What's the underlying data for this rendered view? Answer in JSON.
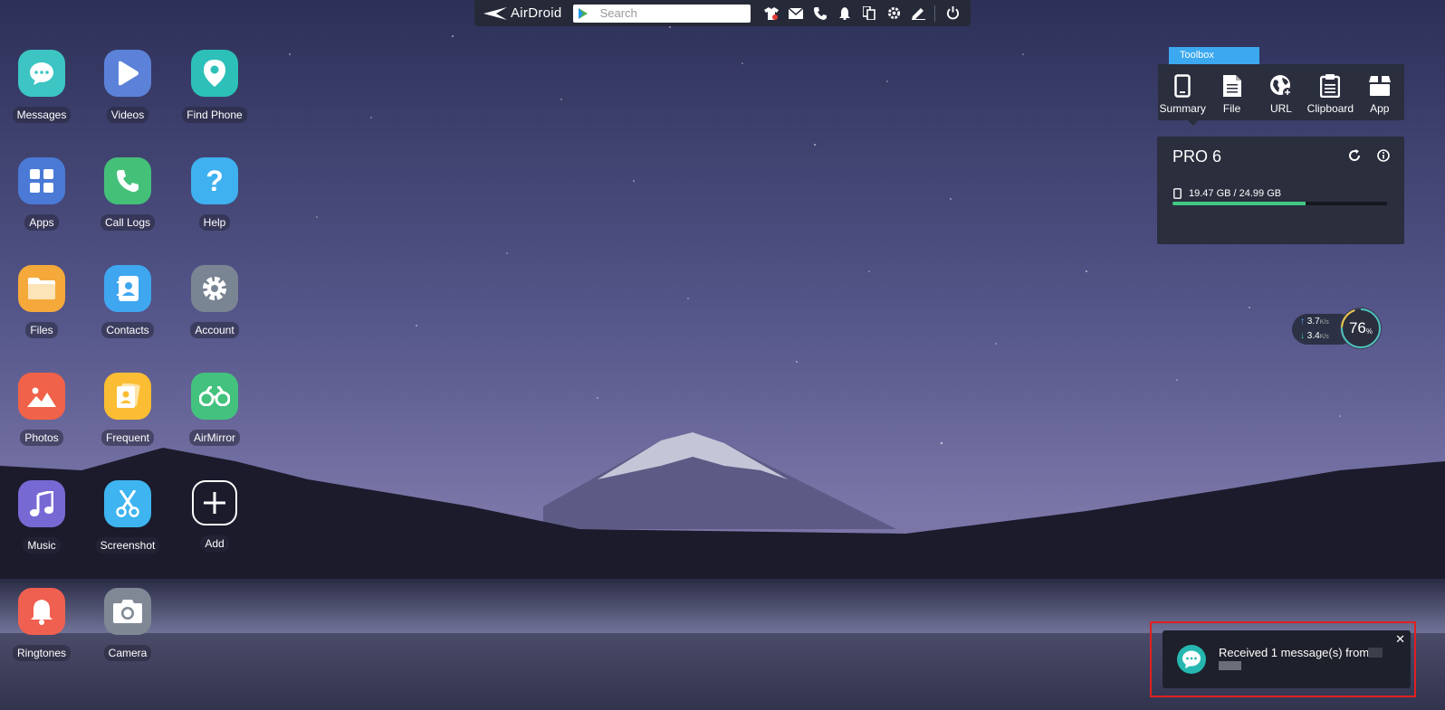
{
  "topbar": {
    "logo_text": "AirDroid",
    "search_placeholder": "Search",
    "icons": [
      "tshirt-icon",
      "mail-icon",
      "phone-icon",
      "bell-icon",
      "transfer-icon",
      "gear-icon",
      "pen-icon",
      "power-icon"
    ]
  },
  "apps": [
    {
      "label": "Messages",
      "color": "#3cc5c2",
      "icon": "chat-bubble-icon"
    },
    {
      "label": "Videos",
      "color": "#5b82d8",
      "icon": "play-icon"
    },
    {
      "label": "Find Phone",
      "color": "#2cc0b9",
      "icon": "location-pin-icon"
    },
    {
      "label": "Apps",
      "color": "#4a7ad6",
      "icon": "grid-icon"
    },
    {
      "label": "Call Logs",
      "color": "#45c079",
      "icon": "phone-call-icon"
    },
    {
      "label": "Help",
      "color": "#3fb1f0",
      "icon": "question-icon"
    },
    {
      "label": "Files",
      "color": "#f5a93b",
      "icon": "folder-icon"
    },
    {
      "label": "Contacts",
      "color": "#3fa6f0",
      "icon": "contact-book-icon"
    },
    {
      "label": "Account",
      "color": "#7a8593",
      "icon": "gear-icon"
    },
    {
      "label": "Photos",
      "color": "#f06249",
      "icon": "landscape-icon"
    },
    {
      "label": "Frequent",
      "color": "#fbbd33",
      "icon": "frequent-contacts-icon"
    },
    {
      "label": "AirMirror",
      "color": "#43c27e",
      "icon": "binoculars-icon"
    },
    {
      "label": "Music",
      "color": "#7669d4",
      "icon": "music-note-icon"
    },
    {
      "label": "Screenshot",
      "color": "#3eb4f0",
      "icon": "scissors-icon"
    },
    {
      "label": "Add",
      "color": "transparent",
      "icon": "plus-icon"
    },
    {
      "label": "Ringtones",
      "color": "#f06050",
      "icon": "bell-icon"
    },
    {
      "label": "Camera",
      "color": "#7f8894",
      "icon": "camera-icon"
    }
  ],
  "toolbox": {
    "tab_label": "Toolbox",
    "tools": [
      {
        "label": "Summary",
        "icon": "phone-outline-icon"
      },
      {
        "label": "File",
        "icon": "document-icon"
      },
      {
        "label": "URL",
        "icon": "globe-icon"
      },
      {
        "label": "Clipboard",
        "icon": "clipboard-icon"
      },
      {
        "label": "App",
        "icon": "package-icon"
      }
    ]
  },
  "device": {
    "name": "PRO 6",
    "storage_text": "19.47 GB / 24.99 GB",
    "storage_used_fraction": 0.62
  },
  "speed": {
    "up": "3.7",
    "down": "3.4",
    "unit": "K/s",
    "percent": "76",
    "percent_unit": "%"
  },
  "notification": {
    "message": "Received 1 message(s) from",
    "close_label": "✕"
  },
  "colors": {
    "accent_blue": "#3ba8f0",
    "storage_green": "#41c985",
    "alert_red": "#e02020"
  }
}
